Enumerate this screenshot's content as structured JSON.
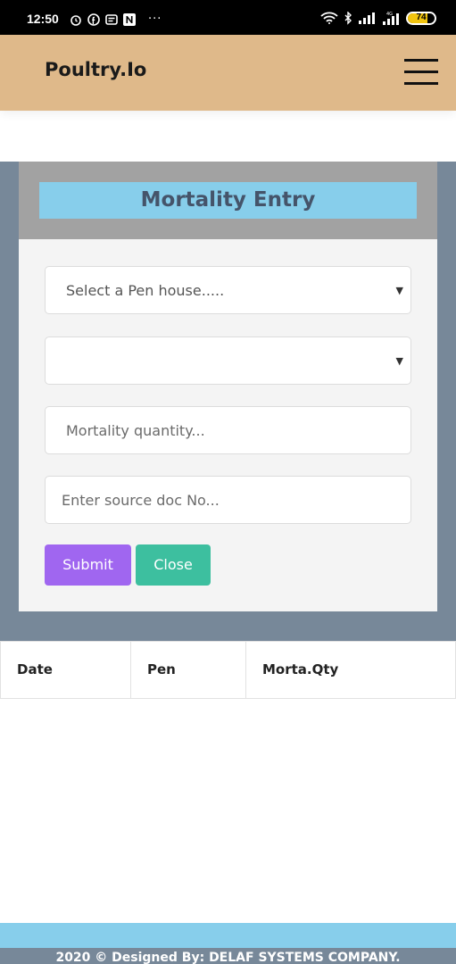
{
  "status_bar": {
    "time": "12:50",
    "notification_icons": [
      "alarm-icon",
      "facebook-icon",
      "message-icon",
      "n-app-icon"
    ],
    "overflow": "···",
    "network": "4G",
    "battery": "74"
  },
  "header": {
    "brand": "Poultry.Io",
    "menu_icon": "hamburger-icon",
    "color": "#dfb98a"
  },
  "form": {
    "title": "Mortality Entry",
    "pen_select": {
      "value": "Select a Pen house....."
    },
    "second_select": {
      "value": ""
    },
    "quantity": {
      "placeholder": "Mortality quantity..."
    },
    "source_doc": {
      "placeholder": "Enter source doc No..."
    },
    "submit_label": "Submit",
    "close_label": "Close",
    "colors": {
      "title_bg": "#87ceeb",
      "submit": "#a066f0",
      "close": "#3dbf9f",
      "section": "#778899"
    }
  },
  "table": {
    "columns": [
      "Date",
      "Pen",
      "Morta.Qty"
    ]
  },
  "footer": {
    "text": "2020 © Designed By: DELAF SYSTEMS COMPANY."
  }
}
